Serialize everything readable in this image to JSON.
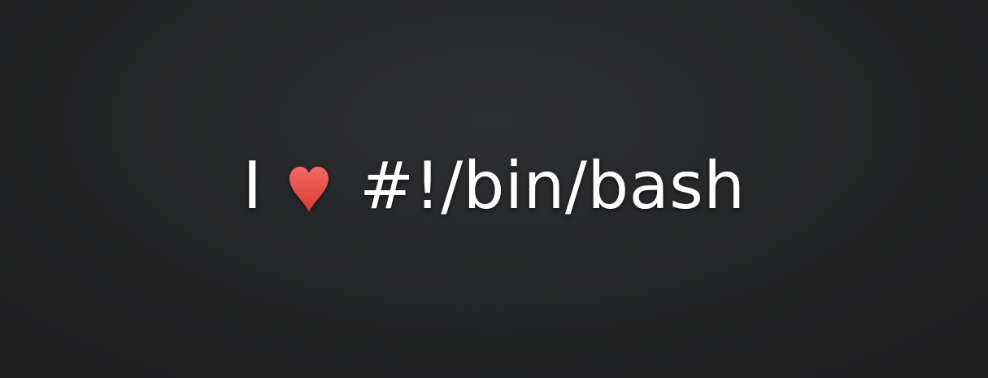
{
  "headline": {
    "word": "I",
    "icon": "heart-icon",
    "icon_color": "#e9443f",
    "text": "#!/bin/bash"
  },
  "colors": {
    "background": "#262728",
    "text": "#ffffff"
  }
}
